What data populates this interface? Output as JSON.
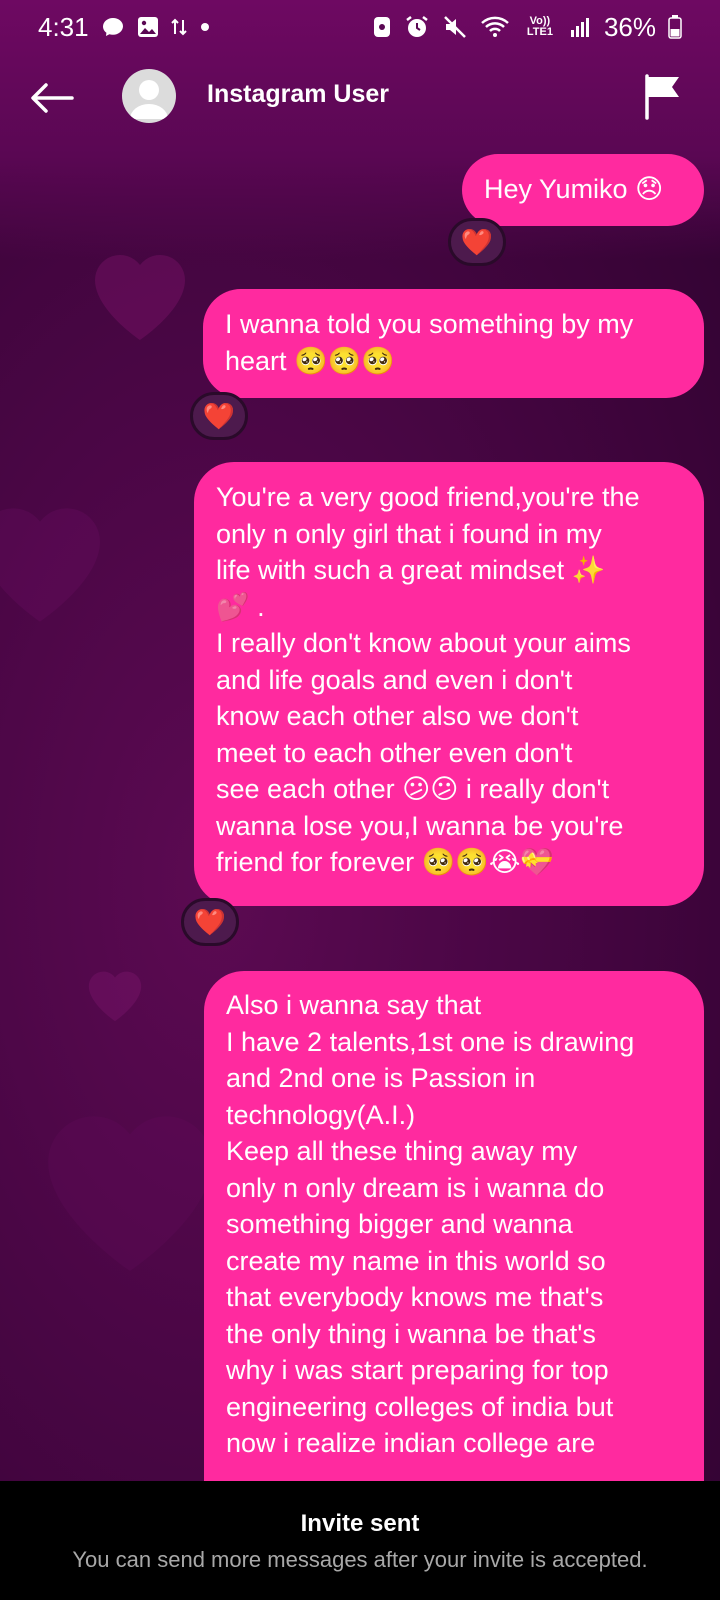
{
  "status_bar": {
    "time": "4:31",
    "battery": "36%",
    "network": "Vo)) LTE1"
  },
  "header": {
    "user_name": "Instagram User"
  },
  "messages": [
    {
      "text": "Hey Yumiko 😞",
      "reaction": "❤️"
    },
    {
      "text": "I wanna told you something by my\nheart 🥺🥺🥺",
      "reaction": "❤️"
    },
    {
      "text": "You're a very good friend,you're the\nonly n only girl that i found in my\nlife with such a great mindset ✨\n💕 .\nI really don't know about your aims\nand life goals and even i don't\nknow each other also we don't\nmeet to each other even don't\nsee each other 😕😕 i really don't\nwanna lose you,I wanna be you're\nfriend for forever 🥺🥺😭💝",
      "reaction": "❤️"
    },
    {
      "text": "Also i wanna say that\nI have 2 talents,1st one is drawing\nand 2nd one is Passion in\ntechnology(A.I.)\nKeep all these thing away my\nonly n only dream is i wanna do\nsomething bigger and wanna\ncreate my name in this world so\nthat everybody knows me that's\nthe only thing i wanna be that's\nwhy i was start preparing for top\nengineering colleges of india but\nnow i realize indian college are"
    }
  ],
  "bottom_bar": {
    "title": "Invite sent",
    "subtitle": "You can send more messages after your invite is accepted."
  },
  "colors": {
    "bubble": "#ff2a9f",
    "background": "#4a0645",
    "reaction_bg": "#4d1a4d"
  },
  "icons": [
    "messenger-icon",
    "gallery-icon",
    "data-transfer-icon",
    "dot-icon",
    "nfc-icon",
    "alarm-icon",
    "mute-icon",
    "wifi-icon",
    "signal-icon",
    "battery-icon",
    "back-arrow-icon",
    "avatar-placeholder-icon",
    "flag-icon",
    "heart-reaction-icon"
  ]
}
